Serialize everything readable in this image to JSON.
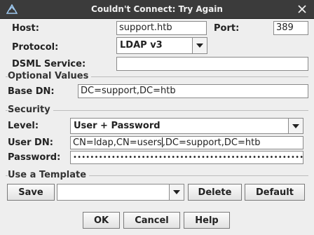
{
  "window": {
    "title": "Couldn't Connect: Try Again"
  },
  "connection": {
    "host_label": "Host:",
    "host_value": "support.htb",
    "port_label": "Port:",
    "port_value": "389",
    "protocol_label": "Protocol:",
    "protocol_value": "LDAP v3",
    "dsml_label": "DSML Service:",
    "dsml_value": ""
  },
  "optional": {
    "title": "Optional Values",
    "base_dn_label": "Base DN:",
    "base_dn_value": "DC=support,DC=htb"
  },
  "security": {
    "title": "Security",
    "level_label": "Level:",
    "level_value": "User + Password",
    "user_dn_label": "User DN:",
    "user_dn_before_caret": "CN=ldap,CN=users",
    "user_dn_after_caret": ",DC=support,DC=htb",
    "password_label": "Password:",
    "password_value": "••••••••••••••••••••••••••••••••••••••••••••••••••••••"
  },
  "template": {
    "title": "Use a Template",
    "save_label": "Save",
    "selected_value": "",
    "delete_label": "Delete",
    "default_label": "Default"
  },
  "buttons": {
    "ok_label": "OK",
    "cancel_label": "Cancel",
    "help_label": "Help"
  },
  "icons": {
    "app": "app-logo-icon",
    "close": "close-icon",
    "dropdown": "chevron-down-icon"
  }
}
